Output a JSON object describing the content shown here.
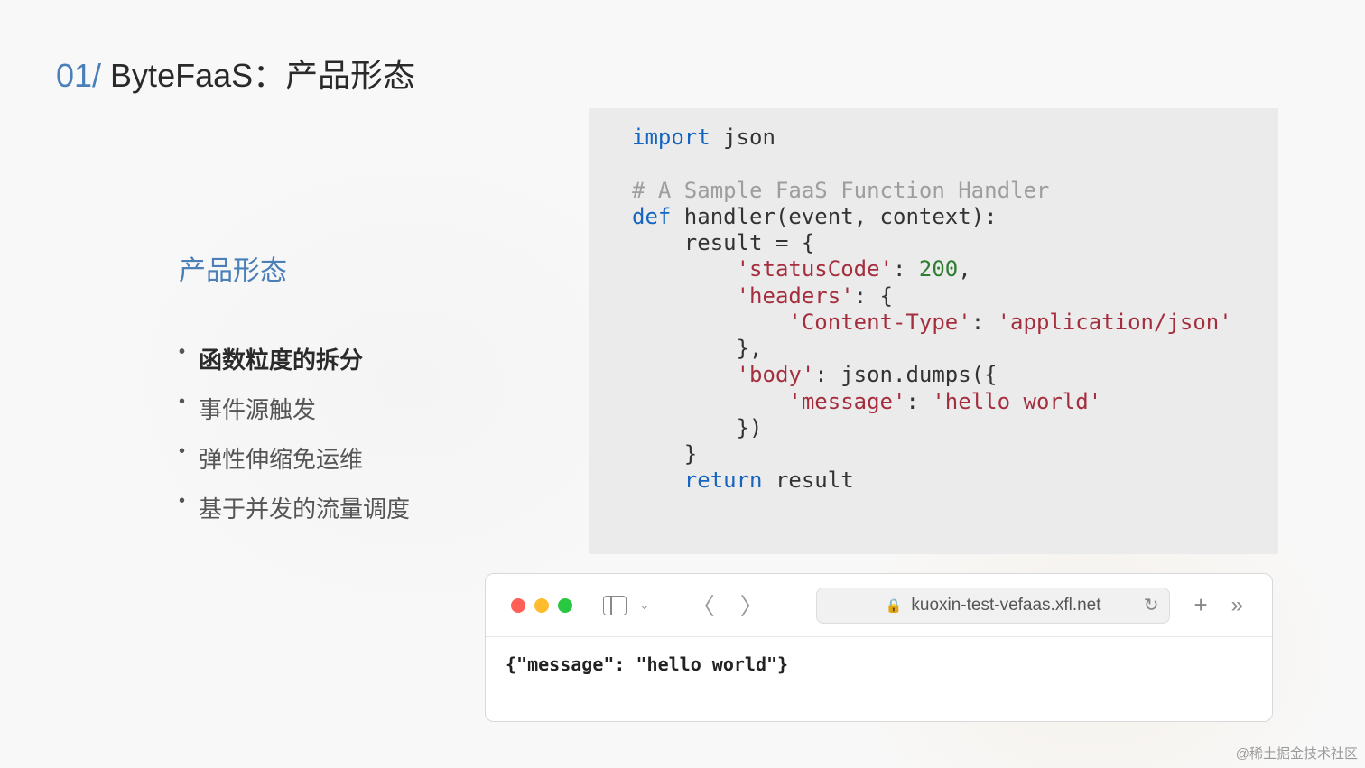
{
  "title": {
    "number": "01/",
    "text": " ByteFaaS：产品形态"
  },
  "left": {
    "subtitle": "产品形态",
    "features": [
      {
        "text": "函数粒度的拆分",
        "bold": true
      },
      {
        "text": "事件源触发",
        "bold": false
      },
      {
        "text": "弹性伸缩免运维",
        "bold": false
      },
      {
        "text": "基于并发的流量调度",
        "bold": false
      }
    ]
  },
  "code": {
    "import_kw": "import",
    "import_mod": " json",
    "comment": "# A Sample FaaS Function Handler",
    "def_kw": "def",
    "def_sig": " handler(event, context):",
    "l1": "    result = {",
    "l2a": "        ",
    "l2b": "'statusCode'",
    "l2c": ": ",
    "l2d": "200",
    "l2e": ",",
    "l3a": "        ",
    "l3b": "'headers'",
    "l3c": ": {",
    "l4a": "            ",
    "l4b": "'Content-Type'",
    "l4c": ": ",
    "l4d": "'application/json'",
    "l5": "        },",
    "l6a": "        ",
    "l6b": "'body'",
    "l6c": ": json.dumps({",
    "l7a": "            ",
    "l7b": "'message'",
    "l7c": ": ",
    "l7d": "'hello world'",
    "l8": "        })",
    "l9": "    }",
    "ret_kw": "    return",
    "ret_val": " result"
  },
  "browser": {
    "url": "kuoxin-test-vefaas.xfl.net",
    "output": "{\"message\": \"hello world\"}"
  },
  "watermark": "@稀土掘金技术社区"
}
